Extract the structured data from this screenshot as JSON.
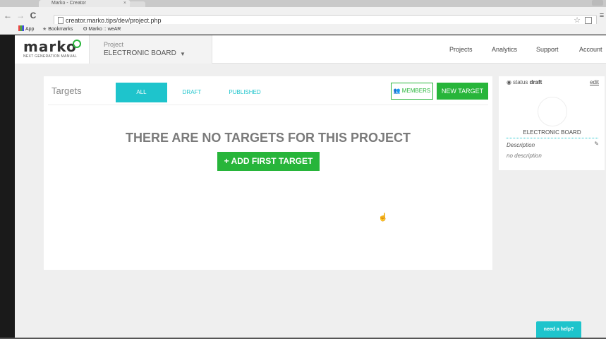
{
  "browser": {
    "tab_title": "Marko - Creator",
    "tab_close": "×",
    "url": "creator.marko.tips/dev/project.php",
    "back": "←",
    "forward": "→",
    "reload": "C",
    "star": "☆",
    "menu": "≡",
    "bookmarks": {
      "apps": "App",
      "bookmarks": "Bookmarks",
      "marko": "Marko :: weAR"
    }
  },
  "app": {
    "logo": "marko",
    "tagline": "NEXT GENERATION MANUAL",
    "project_label": "Project",
    "project_name": "ELECTRONIC BOARD",
    "project_caret": "▼",
    "nav": {
      "projects": "Projects",
      "analytics": "Analytics",
      "support": "Support",
      "account": "Account"
    },
    "targets": {
      "title": "Targets",
      "tabs": {
        "all": "ALL",
        "draft": "DRAFT",
        "published": "PUBLISHED"
      },
      "members_label": "MEMBERS",
      "new_target_label": "NEW TARGET",
      "empty_message": "THERE ARE NO TARGETS FOR THIS PROJECT",
      "add_first_label": "+ ADD FIRST TARGET"
    },
    "sidebar": {
      "status_label": "status",
      "status_value": "draft",
      "edit_label": "edit",
      "name": "ELECTRONIC BOARD",
      "description_label": "Description",
      "description_value": "no description"
    },
    "help_label": "need a help?"
  },
  "colors": {
    "accent_teal": "#1ec4cc",
    "accent_green": "#27b53a"
  }
}
